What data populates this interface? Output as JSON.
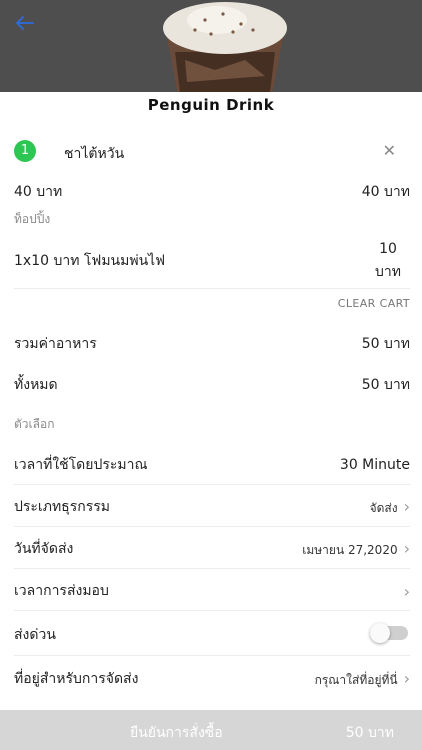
{
  "header": {
    "title": "Penguin Drink"
  },
  "cart_item": {
    "quantity": "1",
    "name": "ชาไต้หวัน",
    "price_left": "40 บาท",
    "price_right": "40 บาท",
    "category": "ท็อปปิ้ง",
    "topping_line": "1x10 บาท โฟมนมพ่นไฟ",
    "topping_price_a": "10",
    "topping_price_b": "บาท"
  },
  "clear_cart": "CLEAR CART",
  "summary": {
    "food_total_label": "รวมค่าอาหาร",
    "food_total_value": "50 บาท",
    "grand_total_label": "ทั้งหมด",
    "grand_total_value": "50 บาท"
  },
  "options": {
    "section_label": "ตัวเลือก",
    "eta_label": "เวลาที่ใช้โดยประมาณ",
    "eta_value": "30 Minute",
    "type_label": "ประเภทธุรกรรม",
    "type_value": "จัดส่ง",
    "date_label": "วันที่จัดส่ง",
    "date_value": "เมษายน 27,2020",
    "time_label": "เวลาการส่งมอบ",
    "express_label": "ส่งด่วน",
    "address_label": "ที่อยู่สำหรับการจัดส่ง",
    "address_value": "กรุณาใส่ที่อยู่ที่นี่"
  },
  "footer": {
    "confirm_label": "ยืนยันการสั่งซื้อ",
    "confirm_total": "50 บาท"
  },
  "icons": {
    "back": "back-arrow-icon",
    "close": "close-icon",
    "chevron": "chevron-right-icon"
  },
  "colors": {
    "accent_green": "#2dc653",
    "hero_bg": "#4e4e4e",
    "disabled_bar": "#d6d6d6"
  }
}
